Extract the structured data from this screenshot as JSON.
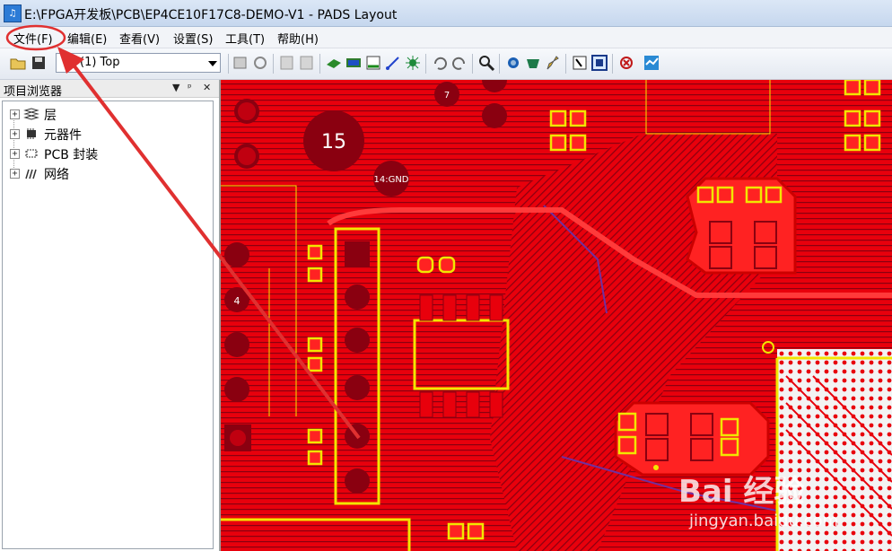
{
  "window": {
    "title": "E:\\FPGA开发板\\PCB\\EP4CE10F17C8-DEMO-V1 - PADS Layout",
    "app_icon": "pads-app-icon"
  },
  "menu": {
    "items": [
      {
        "label": "文件(F)",
        "name": "menu-file"
      },
      {
        "label": "编辑(E)",
        "name": "menu-edit"
      },
      {
        "label": "查看(V)",
        "name": "menu-view"
      },
      {
        "label": "设置(S)",
        "name": "menu-setup"
      },
      {
        "label": "工具(T)",
        "name": "menu-tools"
      },
      {
        "label": "帮助(H)",
        "name": "menu-help"
      }
    ]
  },
  "toolbar": {
    "layer_select_value": "(1) Top",
    "buttons": [
      "open-icon",
      "save-icon",
      "properties-icon",
      "refresh-icon",
      "copy-icon",
      "paste-icon",
      "component-icon",
      "netlist-icon",
      "route-icon",
      "connect-icon",
      "ratsnest-icon",
      "undo-icon",
      "redo-icon",
      "zoom-icon",
      "view-icon",
      "pour-icon",
      "brush-icon",
      "select-icon",
      "board-icon",
      "check-icon",
      "router-icon"
    ]
  },
  "browser": {
    "title": "项目浏览器",
    "controls": [
      "▼",
      "ᵖ",
      "✕"
    ],
    "tree": [
      {
        "label": "层",
        "icon": "layers-icon"
      },
      {
        "label": "元器件",
        "icon": "component-icon"
      },
      {
        "label": "PCB 封装",
        "icon": "footprint-icon"
      },
      {
        "label": "网络",
        "icon": "net-icon"
      }
    ]
  },
  "canvas": {
    "labels": {
      "pad_15": "15",
      "pad_7": "7",
      "pad_14": "14:GND",
      "pad_4": "4"
    }
  },
  "colors": {
    "board_red": "#e8000c",
    "trace_dark": "#a00010",
    "outline_yellow": "#f2e600",
    "purple_trace": "#7030a0",
    "annotation_red": "#e03030"
  },
  "watermark": {
    "main": "Bai 经验",
    "sub": "jingyan.baidu.com"
  }
}
